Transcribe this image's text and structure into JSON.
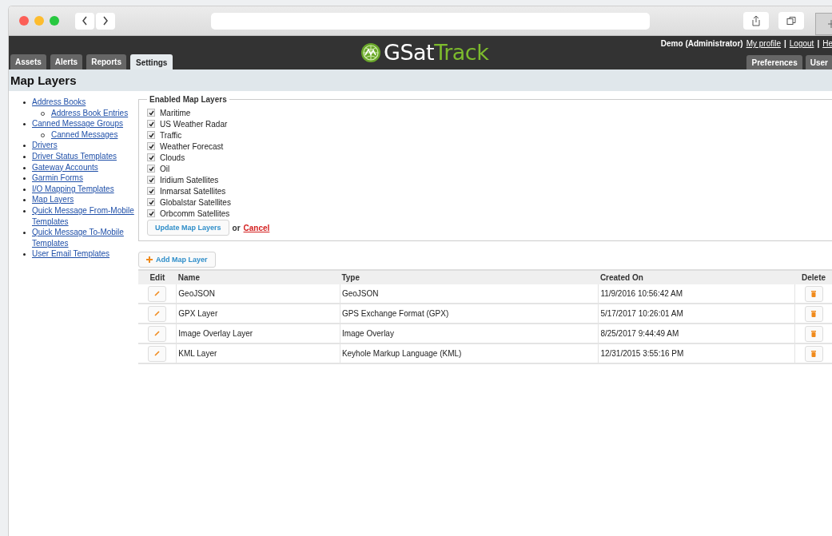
{
  "header": {
    "logo": {
      "prefix": "GSat",
      "suffix": "Track"
    },
    "user": "Demo (Administrator)",
    "links": [
      "My profile",
      "Logout",
      "He"
    ],
    "separator": "|"
  },
  "tabs": [
    {
      "label": "Assets",
      "selected": false
    },
    {
      "label": "Alerts",
      "selected": false
    },
    {
      "label": "Reports",
      "selected": false
    },
    {
      "label": "Settings",
      "selected": true
    }
  ],
  "right_tabs": [
    {
      "label": "Preferences",
      "selected": false
    },
    {
      "label": "User",
      "selected": false
    }
  ],
  "page_title": "Map Layers",
  "sidebar": {
    "items": [
      {
        "label": "Address Books",
        "children": [
          {
            "label": "Address Book Entries"
          }
        ]
      },
      {
        "label": "Canned Message Groups",
        "children": [
          {
            "label": "Canned Messages"
          }
        ]
      },
      {
        "label": "Drivers"
      },
      {
        "label": "Driver Status Templates"
      },
      {
        "label": "Gateway Accounts"
      },
      {
        "label": "Garmin Forms"
      },
      {
        "label": "I/O Mapping Templates"
      },
      {
        "label": "Map Layers"
      },
      {
        "label": "Quick Message From-Mobile Templates"
      },
      {
        "label": "Quick Message To-Mobile Templates"
      },
      {
        "label": "User Email Templates"
      }
    ]
  },
  "enabled_layers": {
    "legend": "Enabled Map Layers",
    "items": [
      {
        "label": "Maritime",
        "checked": true
      },
      {
        "label": "US Weather Radar",
        "checked": true
      },
      {
        "label": "Traffic",
        "checked": true
      },
      {
        "label": "Weather Forecast",
        "checked": true
      },
      {
        "label": "Clouds",
        "checked": true
      },
      {
        "label": "Oil",
        "checked": true
      },
      {
        "label": "Iridium Satellites",
        "checked": true
      },
      {
        "label": "Inmarsat Satellites",
        "checked": true
      },
      {
        "label": "Globalstar Satellites",
        "checked": true
      },
      {
        "label": "Orbcomm Satellites",
        "checked": true
      }
    ],
    "update_button": "Update Map Layers",
    "or": "or",
    "cancel": "Cancel"
  },
  "add_button": "Add Map Layer",
  "table": {
    "columns": [
      "Edit",
      "Name",
      "Type",
      "Created On",
      "Delete"
    ],
    "rows": [
      {
        "name": "GeoJSON",
        "type": "GeoJSON",
        "created_on": "11/9/2016 10:56:42 AM"
      },
      {
        "name": "GPX Layer",
        "type": "GPS Exchange Format (GPX)",
        "created_on": "5/17/2017 10:26:01 AM"
      },
      {
        "name": "Image Overlay Layer",
        "type": "Image Overlay",
        "created_on": "8/25/2017 9:44:49 AM"
      },
      {
        "name": "KML Layer",
        "type": "Keyhole Markup Language (KML)",
        "created_on": "12/31/2015 3:55:16 PM"
      }
    ]
  }
}
